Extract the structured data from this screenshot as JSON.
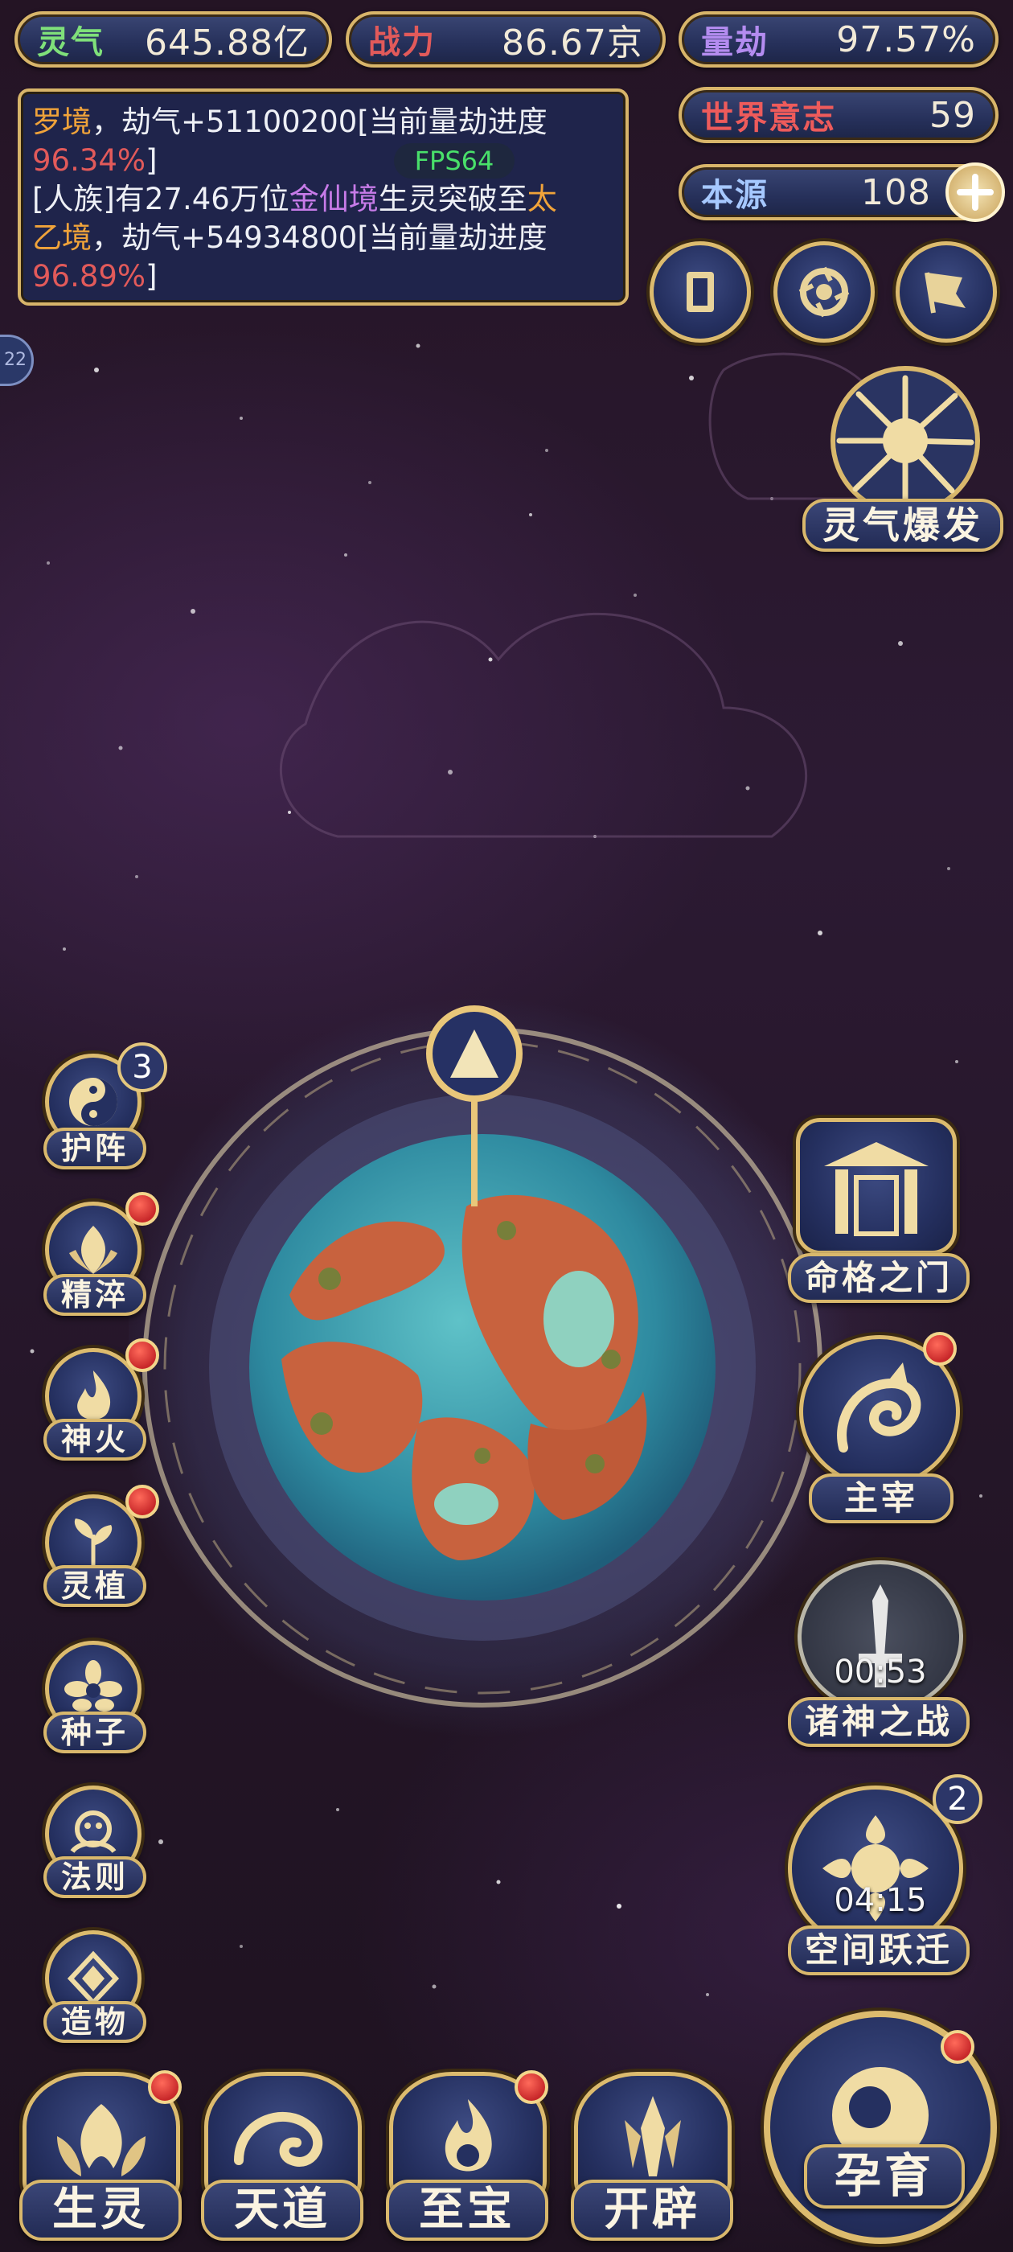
{
  "stats": {
    "lingqi": {
      "label": "灵气",
      "value": "645.88亿",
      "color": "#7fe07a"
    },
    "zhanli": {
      "label": "战力",
      "value": "86.67京",
      "color": "#e25a5a"
    },
    "liangjie": {
      "label": "量劫",
      "value": "97.57%",
      "color": "#b48cf0"
    },
    "shijie": {
      "label": "世界意志",
      "value": "59",
      "color": "#ee5b5b"
    },
    "benyuan": {
      "label": "本源",
      "value": "108",
      "color": "#a6c8ff"
    }
  },
  "log": {
    "line1_a": "罗境",
    "line1_b": "，劫气+51100200[当前量劫进度",
    "line2": "96.34%",
    "line2_end": "]",
    "line3_a": "[人族]有27.46万位",
    "line3_b": "金仙境",
    "line3_c": "生灵突破至",
    "line3_d": "太",
    "line4_a": "乙境",
    "line4_b": "，劫气+54934800[当前量劫进度",
    "line5": "96.89%",
    "line5_end": "]"
  },
  "fps": "FPS64",
  "side_tab": "22",
  "top_icons": [
    "card-icon",
    "vortex-icon",
    "flag-icon"
  ],
  "burst": {
    "label": "灵气爆发"
  },
  "left_menu": [
    {
      "label": "护阵",
      "icon": "yin-yang-icon",
      "badge": "3"
    },
    {
      "label": "精淬",
      "icon": "lotus-flame-icon",
      "dot": true
    },
    {
      "label": "神火",
      "icon": "fire-icon",
      "dot": true
    },
    {
      "label": "灵植",
      "icon": "plant-icon",
      "dot": true
    },
    {
      "label": "种子",
      "icon": "seed-flower-icon"
    },
    {
      "label": "法则",
      "icon": "rule-icon"
    },
    {
      "label": "造物",
      "icon": "diamond-icon"
    }
  ],
  "right_menu": [
    {
      "label": "命格之门",
      "icon": "gate-icon"
    },
    {
      "label": "主宰",
      "icon": "dragon-icon",
      "dot": true
    },
    {
      "label": "诸神之战",
      "icon": "sword-icon",
      "timer": "00:53"
    },
    {
      "label": "空间跃迁",
      "icon": "portal-icon",
      "timer": "04:15",
      "badge": "2"
    }
  ],
  "bottom_nav": [
    {
      "label": "生灵",
      "dot": true
    },
    {
      "label": "天道"
    },
    {
      "label": "至宝",
      "dot": true
    },
    {
      "label": "开辟"
    }
  ],
  "yunyu": {
    "label": "孕育",
    "dot": true
  },
  "colors": {
    "gold": "#d9b86c",
    "navy": "#253060",
    "ocean": "#3fa0b2",
    "land": "#c8623e"
  }
}
